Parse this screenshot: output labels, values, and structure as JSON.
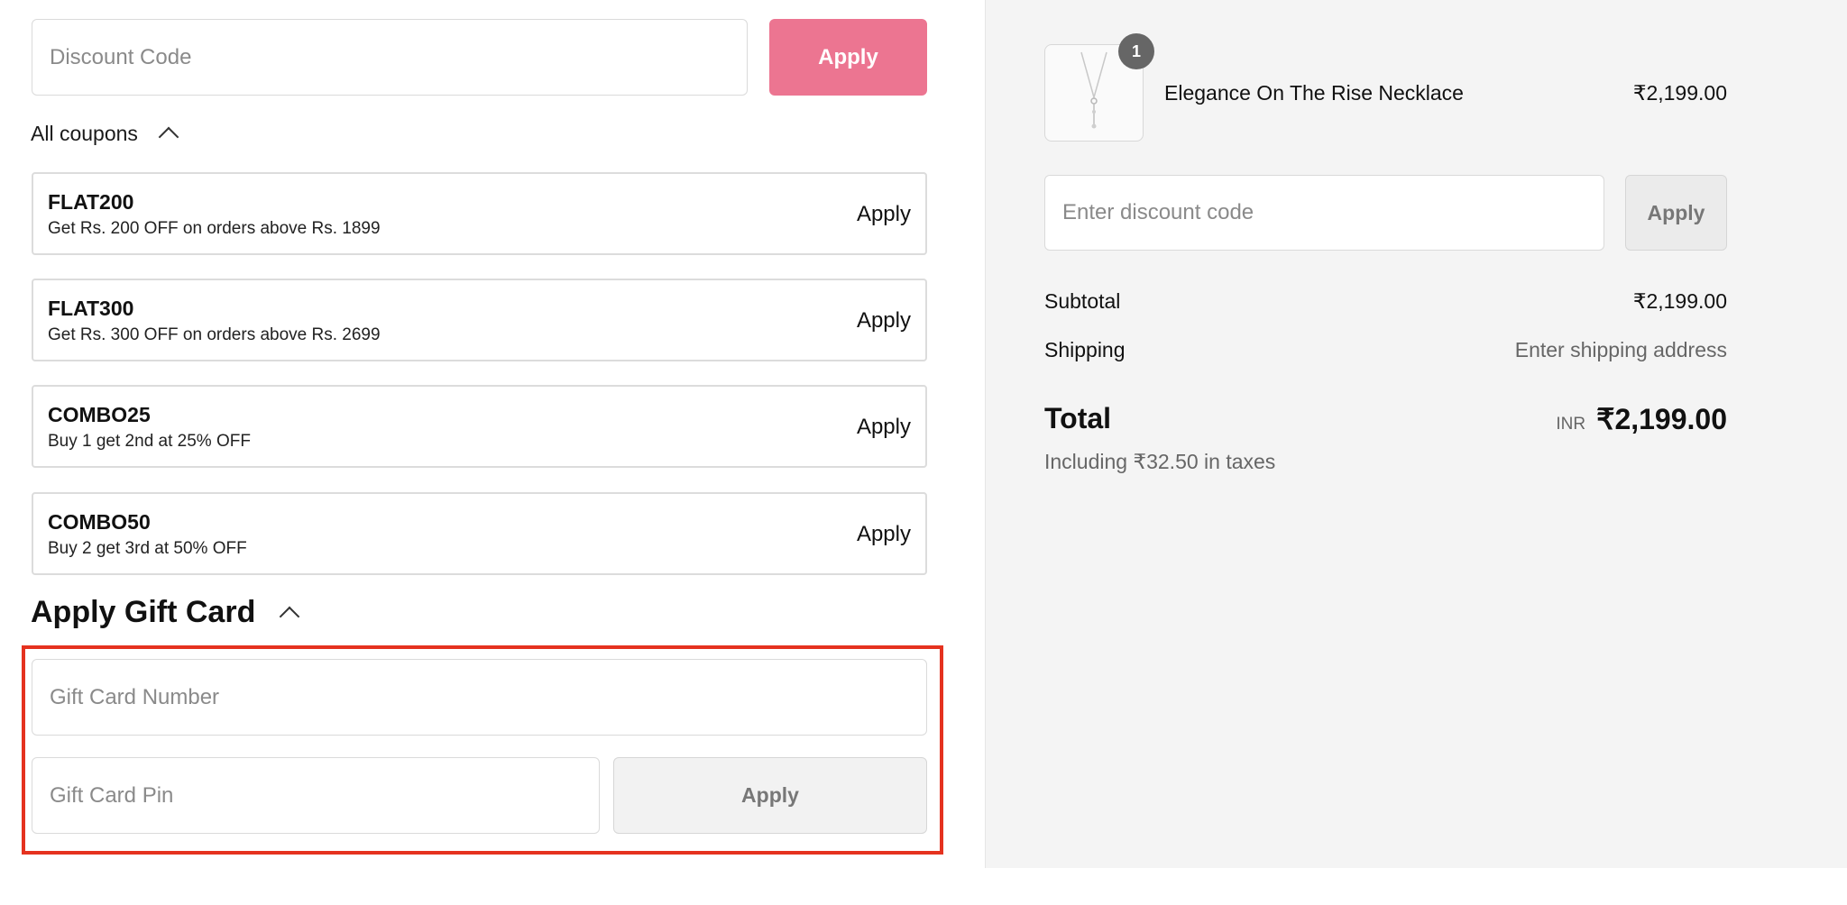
{
  "discount": {
    "placeholder": "Discount Code",
    "apply_label": "Apply",
    "accent": "#ec7591"
  },
  "coupons": {
    "toggle_label": "All coupons",
    "items": [
      {
        "code": "FLAT200",
        "description": "Get Rs. 200 OFF on orders above Rs. 1899",
        "apply_label": "Apply"
      },
      {
        "code": "FLAT300",
        "description": "Get Rs. 300 OFF on orders above Rs. 2699",
        "apply_label": "Apply"
      },
      {
        "code": "COMBO25",
        "description": "Buy 1 get 2nd at 25% OFF",
        "apply_label": "Apply"
      },
      {
        "code": "COMBO50",
        "description": "Buy 2 get 3rd at 50% OFF",
        "apply_label": "Apply"
      }
    ]
  },
  "gift_card": {
    "title": "Apply Gift Card",
    "number_placeholder": "Gift Card Number",
    "pin_placeholder": "Gift Card Pin",
    "apply_label": "Apply",
    "highlight_color": "#e5321f"
  },
  "summary": {
    "item": {
      "quantity": "1",
      "name": "Elegance On The Rise Necklace",
      "price": "₹2,199.00"
    },
    "discount_placeholder": "Enter discount code",
    "discount_apply_label": "Apply",
    "subtotal_label": "Subtotal",
    "subtotal_value": "₹2,199.00",
    "shipping_label": "Shipping",
    "shipping_value": "Enter shipping address",
    "total_label": "Total",
    "currency": "INR",
    "total_value": "₹2,199.00",
    "taxes_note": "Including ₹32.50 in taxes"
  }
}
